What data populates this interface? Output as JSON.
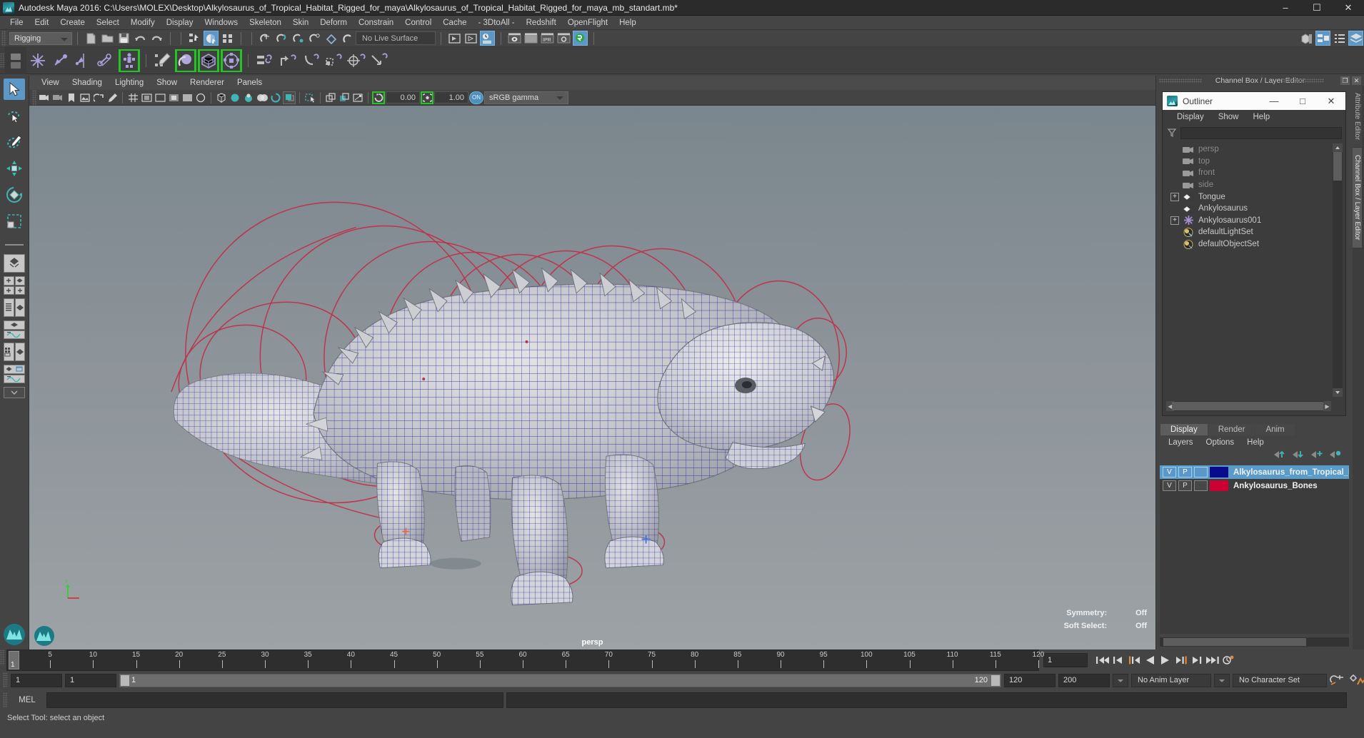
{
  "titlebar": {
    "title": "Autodesk Maya 2016: C:\\Users\\MOLEX\\Desktop\\Alkylosaurus_of_Tropical_Habitat_Rigged_for_maya\\Alkylosaurus_of_Tropical_Habitat_Rigged_for_maya_mb_standart.mb*",
    "minimize": "–",
    "maximize": "☐",
    "close": "✕"
  },
  "menubar": {
    "items": [
      "File",
      "Edit",
      "Create",
      "Select",
      "Modify",
      "Display",
      "Windows",
      "Skeleton",
      "Skin",
      "Deform",
      "Constrain",
      "Control",
      "Cache",
      "- 3DtoAll -",
      "Redshift",
      "OpenFlight",
      "Help"
    ]
  },
  "statusbar": {
    "menu_set": "Rigging",
    "live_surface": "No Live Surface"
  },
  "viewport_menu": {
    "items": [
      "View",
      "Shading",
      "Lighting",
      "Show",
      "Renderer",
      "Panels"
    ]
  },
  "viewport_tools": {
    "exposure_value": "0.00",
    "gamma_value": "1.00",
    "on_label": "ON",
    "color_profile": "sRGB gamma"
  },
  "viewport": {
    "camera_label": "persp",
    "symmetry_label": "Symmetry:",
    "symmetry_value": "Off",
    "soft_select_label": "Soft Select:",
    "soft_select_value": "Off"
  },
  "channelbox_header": {
    "title": "Channel Box / Layer Editor",
    "restore": "❐",
    "close": "✕"
  },
  "vertical_tabs": [
    {
      "label": "Attribute Editor",
      "active": false
    },
    {
      "label": "Channel Box / Layer Editor",
      "active": true
    }
  ],
  "outliner": {
    "title": "Outliner",
    "minimize": "—",
    "maximize": "□",
    "close": "✕",
    "menu": [
      "Display",
      "Show",
      "Help"
    ],
    "search_value": "",
    "items": [
      {
        "label": "persp",
        "icon": "camera-icon",
        "expandable": false,
        "dim": true
      },
      {
        "label": "top",
        "icon": "camera-icon",
        "expandable": false,
        "dim": true
      },
      {
        "label": "front",
        "icon": "camera-icon",
        "expandable": false,
        "dim": true
      },
      {
        "label": "side",
        "icon": "camera-icon",
        "expandable": false,
        "dim": true
      },
      {
        "label": "Tongue",
        "icon": "mesh-icon",
        "expandable": true,
        "dim": false
      },
      {
        "label": "Ankylosaurus",
        "icon": "mesh-icon",
        "expandable": false,
        "dim": false
      },
      {
        "label": "Ankylosaurus001",
        "icon": "joint-icon",
        "expandable": true,
        "dim": false
      },
      {
        "label": "defaultLightSet",
        "icon": "set-icon",
        "expandable": false,
        "dim": false
      },
      {
        "label": "defaultObjectSet",
        "icon": "set-icon",
        "expandable": false,
        "dim": false
      }
    ]
  },
  "layer_editor": {
    "tabs": [
      {
        "label": "Display",
        "active": true
      },
      {
        "label": "Render",
        "active": false
      },
      {
        "label": "Anim",
        "active": false
      }
    ],
    "menu": [
      "Layers",
      "Options",
      "Help"
    ],
    "layers": [
      {
        "v": "V",
        "p": "P",
        "color": "#0a0a8c",
        "name": "Alkylosaurus_from_Tropical_Hab",
        "selected": true
      },
      {
        "v": "V",
        "p": "P",
        "color": "#cc0033",
        "name": "Ankylosaurus_Bones",
        "selected": false
      }
    ]
  },
  "timeline": {
    "current_frame_label": "1",
    "frame_field": "1",
    "ticks": [
      5,
      10,
      15,
      20,
      25,
      30,
      35,
      40,
      45,
      50,
      55,
      60,
      65,
      70,
      75,
      80,
      85,
      90,
      95,
      100,
      105,
      110,
      115,
      120
    ],
    "range_start": "1",
    "range_end": "1",
    "slider_start": "1",
    "slider_end": "120",
    "playback_start": "120",
    "playback_end": "200",
    "anim_layer": "No Anim Layer",
    "character_set": "No Character Set"
  },
  "command_line": {
    "language": "MEL",
    "input_value": "",
    "output_value": ""
  },
  "status_line": {
    "message": "Select Tool: select an object"
  },
  "colors": {
    "accent_blue": "#5b97c7",
    "shelf_green": "#27c427",
    "icon_purple": "#a8a0d8",
    "icon_cyan": "#3fb5b5",
    "viewport_sky": "#8a9299",
    "wireframe_blue": "#1a1a9e",
    "control_red": "#c8304a"
  }
}
